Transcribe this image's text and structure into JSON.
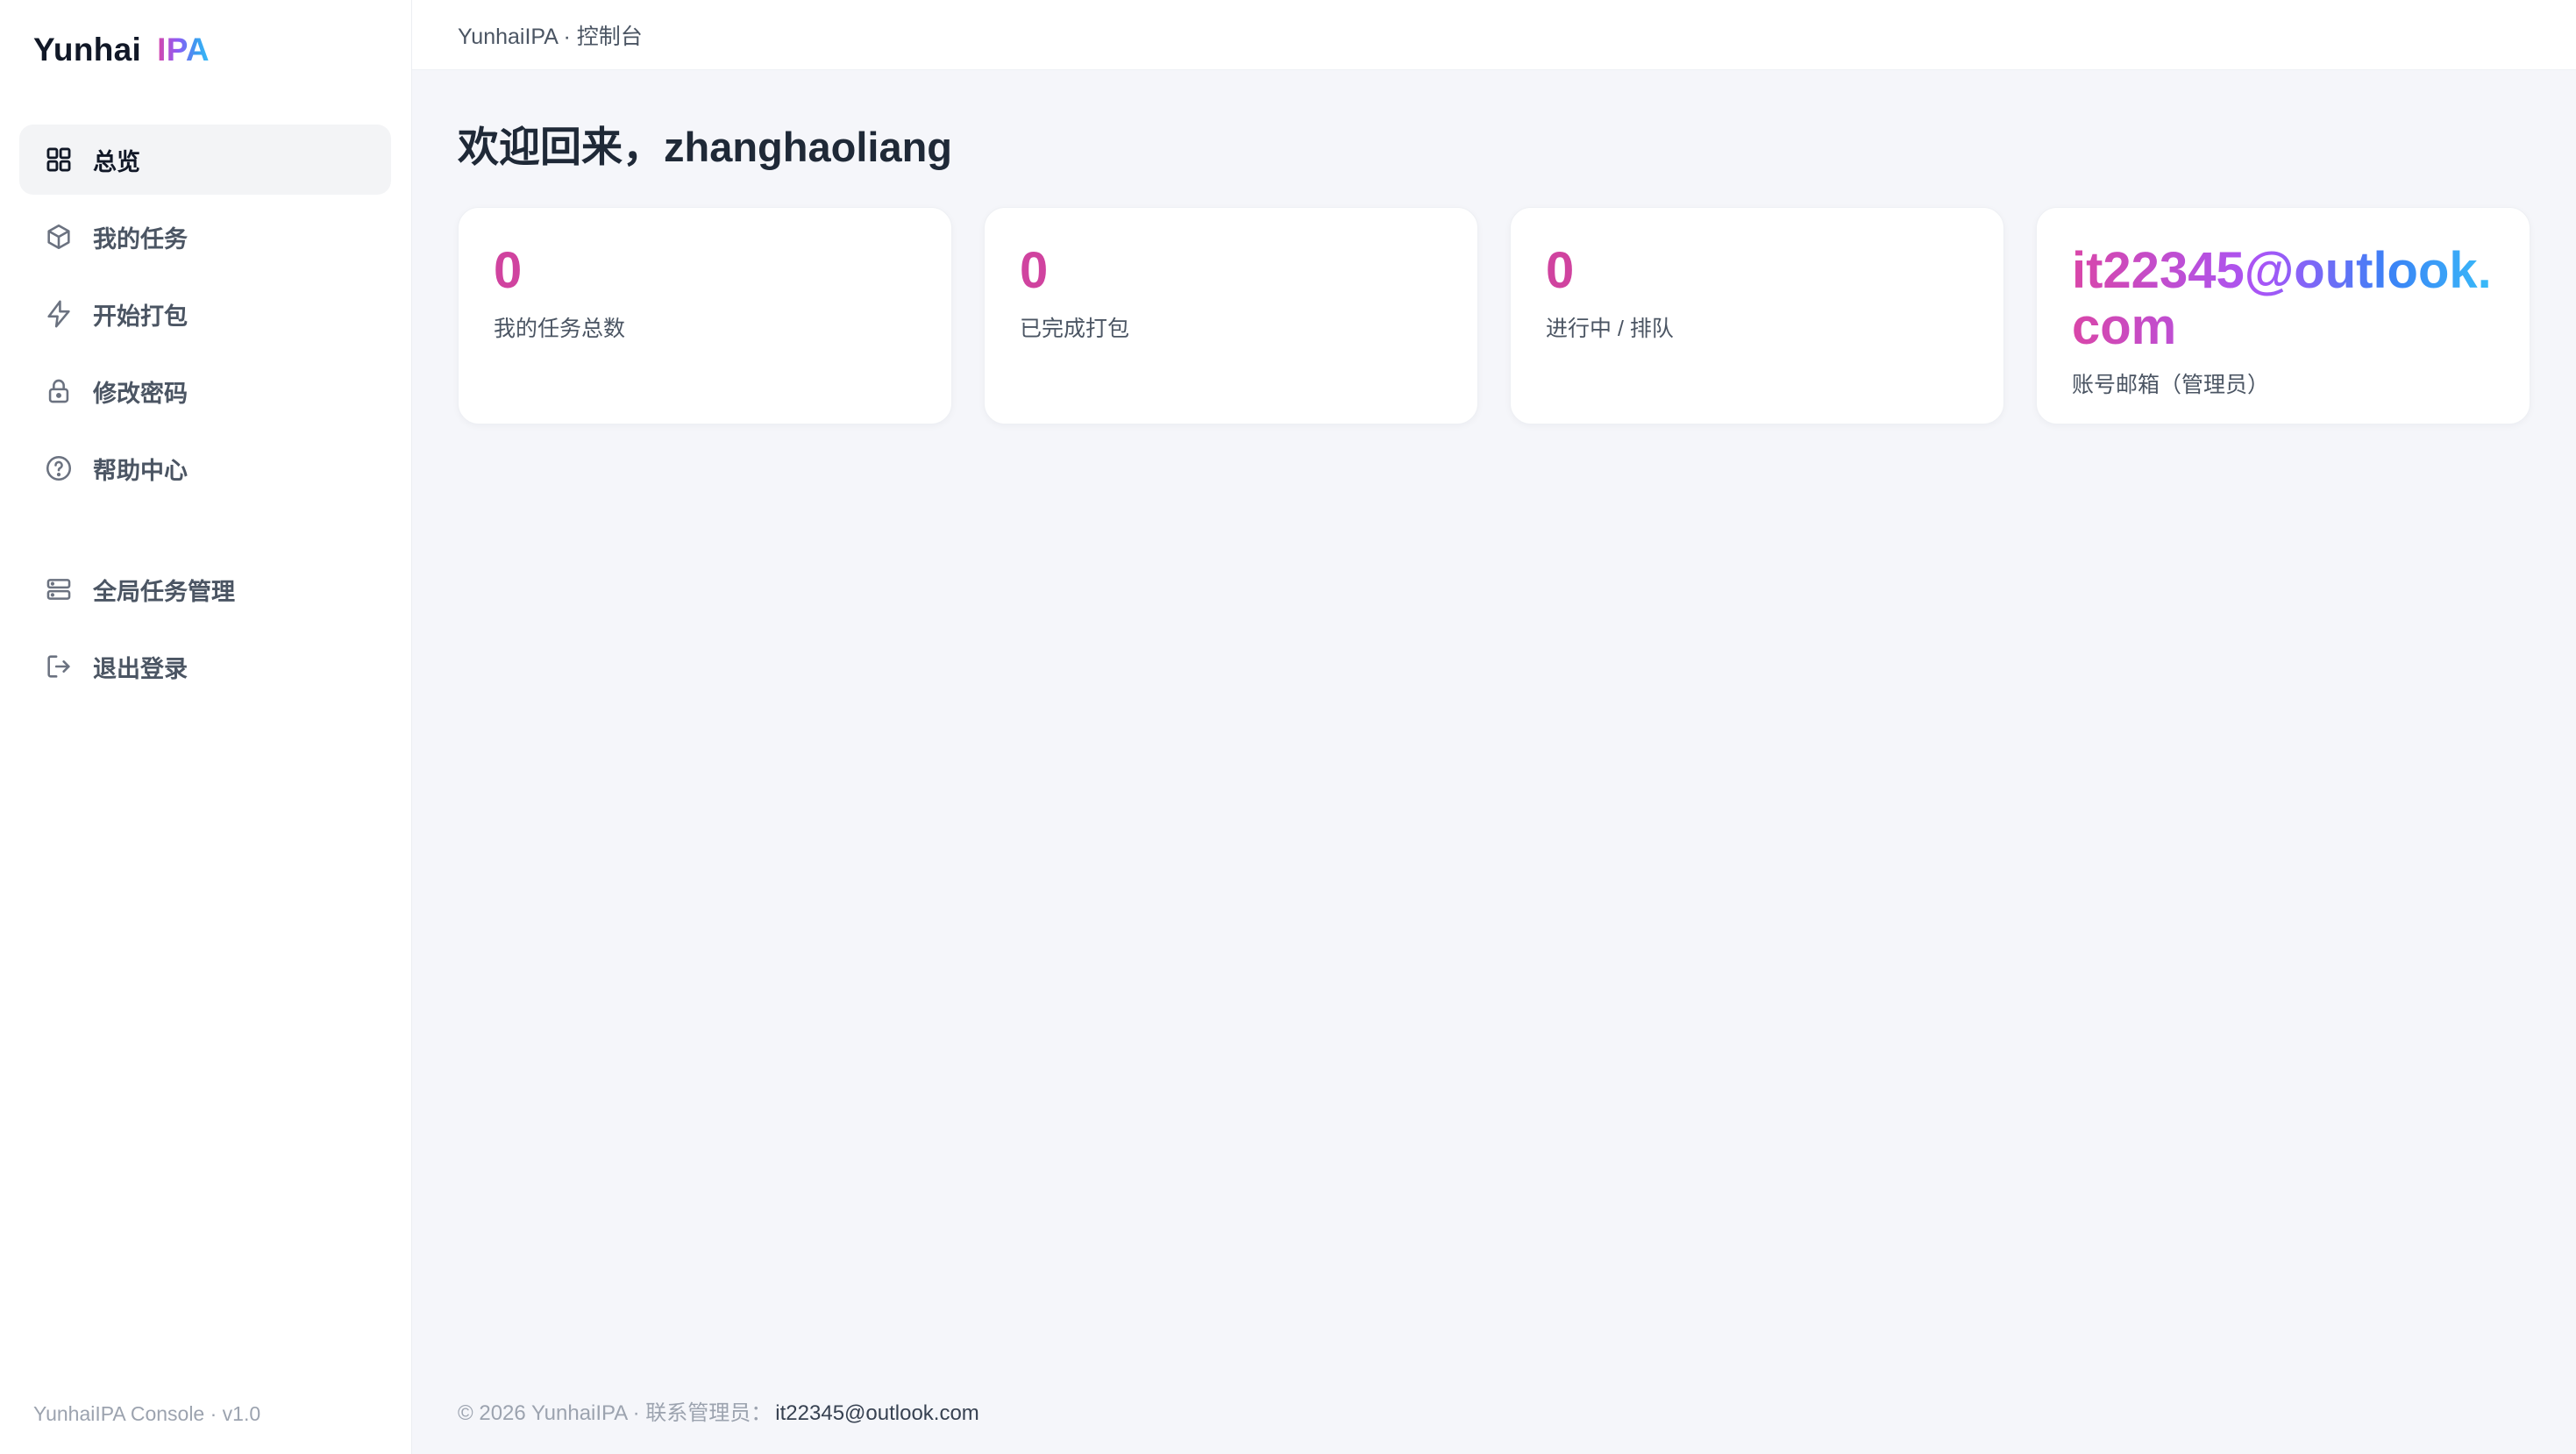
{
  "brand": {
    "main": "Yunhai",
    "accent": "IPA"
  },
  "sidebar": {
    "items": [
      {
        "label": "总览",
        "icon": "grid-icon",
        "active": true
      },
      {
        "label": "我的任务",
        "icon": "box-icon"
      },
      {
        "label": "开始打包",
        "icon": "lightning-icon"
      },
      {
        "label": "修改密码",
        "icon": "lock-icon"
      },
      {
        "label": "帮助中心",
        "icon": "help-circle-icon"
      },
      {
        "label": "全局任务管理",
        "icon": "server-icon"
      },
      {
        "label": "退出登录",
        "icon": "logout-icon"
      }
    ],
    "footer": "YunhaiIPA Console · v1.0"
  },
  "topbar": {
    "breadcrumb": "YunhaiIPA · 控制台"
  },
  "main": {
    "welcome": "欢迎回来，zhanghaoliang",
    "cards": [
      {
        "value": "0",
        "label": "我的任务总数"
      },
      {
        "value": "0",
        "label": "已完成打包"
      },
      {
        "value": "0",
        "label": "进行中 / 排队"
      },
      {
        "value": "it22345@outlook.com",
        "label": "账号邮箱（管理员）"
      }
    ]
  },
  "footer": {
    "text": "© 2026 YunhaiIPA · 联系管理员：",
    "email": "it22345@outlook.com"
  },
  "colors": {
    "accent_pink": "#d0439f",
    "accent_blue": "#38bdf8",
    "active_bg": "#f3f4f6"
  }
}
